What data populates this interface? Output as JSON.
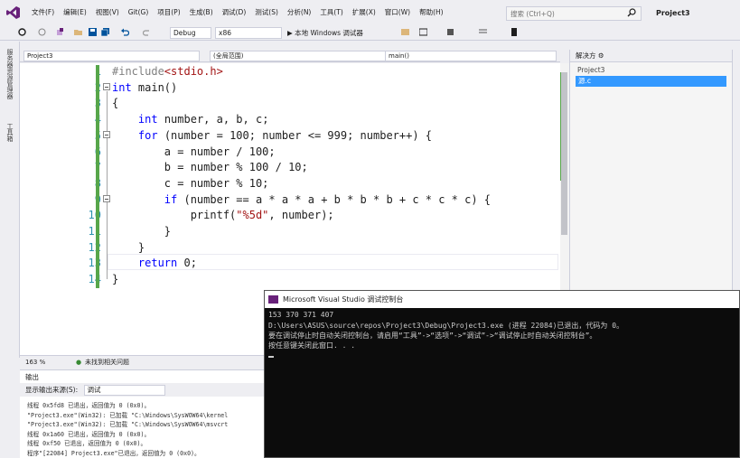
{
  "menu": {
    "items": [
      "文件(F)",
      "编辑(E)",
      "视图(V)",
      "Git(G)",
      "项目(P)",
      "生成(B)",
      "调试(D)",
      "测试(S)",
      "分析(N)",
      "工具(T)",
      "扩展(X)",
      "窗口(W)",
      "帮助(H)"
    ],
    "search_placeholder": "搜索 (Ctrl+Q)",
    "project_name": "Project3"
  },
  "toolbar": {
    "config": "Debug",
    "platform": "x86",
    "run_label": "▶ 本地 Windows 调试器"
  },
  "left_tabs": [
    "服务器资源管理器",
    "工具箱"
  ],
  "nav": {
    "project": "Project3",
    "scope": "(全局范围)",
    "function": "main()"
  },
  "editor": {
    "line_numbers": [
      "1",
      "2",
      "3",
      "4",
      "5",
      "6",
      "7",
      "8",
      "9",
      "10",
      "11",
      "12",
      "13",
      "14"
    ],
    "lines": [
      {
        "parts": [
          [
            "inc",
            "#include"
          ],
          [
            "str",
            "<stdio.h>"
          ]
        ]
      },
      {
        "parts": [
          [
            "kw",
            "int"
          ],
          [
            "",
            " main()"
          ]
        ]
      },
      {
        "parts": [
          [
            "",
            "{"
          ]
        ]
      },
      {
        "parts": [
          [
            "",
            "    "
          ],
          [
            "kw",
            "int"
          ],
          [
            "",
            " number, a, b, c;"
          ]
        ]
      },
      {
        "parts": [
          [
            "",
            "    "
          ],
          [
            "kw",
            "for"
          ],
          [
            "",
            " (number = 100; number <= 999; number++) {"
          ]
        ]
      },
      {
        "parts": [
          [
            "",
            "        a = number / 100;"
          ]
        ]
      },
      {
        "parts": [
          [
            "",
            "        b = number % 100 / 10;"
          ]
        ]
      },
      {
        "parts": [
          [
            "",
            "        c = number % 10;"
          ]
        ]
      },
      {
        "parts": [
          [
            "",
            "        "
          ],
          [
            "kw",
            "if"
          ],
          [
            "",
            " (number == a * a * a + b * b * b + c * c * c) {"
          ]
        ]
      },
      {
        "parts": [
          [
            "",
            "            printf("
          ],
          [
            "str",
            "\"%5d\""
          ],
          [
            "",
            ", number);"
          ]
        ]
      },
      {
        "parts": [
          [
            "",
            "        }"
          ]
        ]
      },
      {
        "parts": [
          [
            "",
            "    }"
          ]
        ]
      },
      {
        "parts": [
          [
            "",
            "    "
          ],
          [
            "kw",
            "return"
          ],
          [
            "",
            " 0;"
          ]
        ]
      },
      {
        "parts": [
          [
            "",
            "}"
          ]
        ]
      }
    ]
  },
  "editor_status": {
    "zoom": "163 %",
    "issues": "未找到相关问题"
  },
  "output": {
    "title": "输出",
    "source_label": "显示输出来源(S):",
    "source_value": "调试",
    "lines": [
      "线程 0x5fd8 已退出，返回值为 0 (0x0)。",
      "\"Project3.exe\"(Win32): 已加载 \"C:\\Windows\\SysWOW64\\kernel",
      "\"Project3.exe\"(Win32): 已加载 \"C:\\Windows\\SysWOW64\\msvcrt",
      "线程 0x1a60 已退出，返回值为 0 (0x0)。",
      "线程 0xf50 已退出，返回值为 0 (0x0)。",
      "程序\"[22084] Project3.exe\"已退出，返回值为 0 (0x0)。"
    ]
  },
  "solution": {
    "header": "解决方 ⚙",
    "project": "Project3",
    "file": "源.c"
  },
  "console": {
    "title": "Microsoft Visual Studio 调试控制台",
    "lines": [
      "  153  370  371  407",
      "D:\\Users\\ASUS\\source\\repos\\Project3\\Debug\\Project3.exe (进程 22084)已退出，代码为 0。",
      "要在调试停止时自动关闭控制台，请启用“工具”->“选项”->“调试”->“调试停止时自动关闭控制台”。",
      "按任意键关闭此窗口. . ."
    ]
  },
  "colors": {
    "keyword": "#0000ff",
    "string": "#a31515",
    "line_number": "#2b91af",
    "change_bar": "#57a64a",
    "vs_purple": "#68217a"
  }
}
